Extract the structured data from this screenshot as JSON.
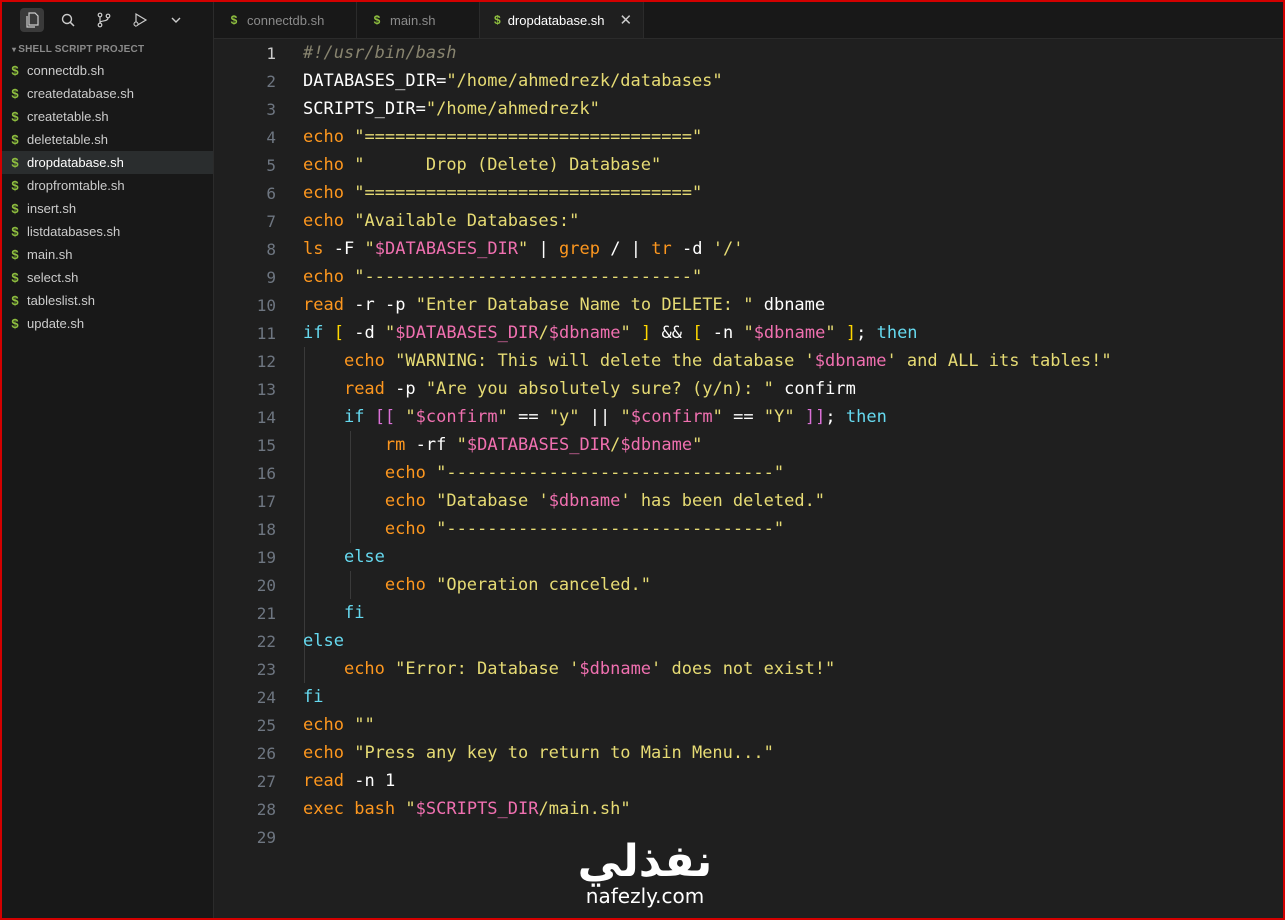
{
  "sidebar": {
    "section_title": "SHELL SCRIPT PROJECT",
    "files": [
      {
        "name": "connectdb.sh",
        "icon": "dollar-file-icon"
      },
      {
        "name": "createdatabase.sh",
        "icon": "dollar-file-icon"
      },
      {
        "name": "createtable.sh",
        "icon": "dollar-file-icon"
      },
      {
        "name": "deletetable.sh",
        "icon": "dollar-file-icon"
      },
      {
        "name": "dropdatabase.sh",
        "icon": "dollar-file-icon",
        "selected": true
      },
      {
        "name": "dropfromtable.sh",
        "icon": "dollar-file-icon"
      },
      {
        "name": "insert.sh",
        "icon": "dollar-file-icon"
      },
      {
        "name": "listdatabases.sh",
        "icon": "dollar-file-icon"
      },
      {
        "name": "main.sh",
        "icon": "dollar-file-icon"
      },
      {
        "name": "select.sh",
        "icon": "dollar-file-icon"
      },
      {
        "name": "tableslist.sh",
        "icon": "dollar-file-icon"
      },
      {
        "name": "update.sh",
        "icon": "dollar-file-icon"
      }
    ],
    "toolbar_icons": [
      "files-icon",
      "search-icon",
      "source-control-icon",
      "run-debug-icon",
      "chevron-down-icon"
    ]
  },
  "tabs": [
    {
      "label": "connectdb.sh",
      "active": false
    },
    {
      "label": "main.sh",
      "active": false
    },
    {
      "label": "dropdatabase.sh",
      "active": true,
      "close": "✕"
    }
  ],
  "file_marker": "$",
  "colors": {
    "keyword": "#fd971f",
    "string": "#e6db74",
    "variable": "#f070b0",
    "control": "#66d9ef",
    "comment": "#88846f",
    "accent_border": "#d30000"
  },
  "editor": {
    "current_line": 1,
    "lines": [
      {
        "n": "1",
        "text": "#!/usr/bin/bash"
      },
      {
        "n": "2",
        "text": "DATABASES_DIR=\"/home/ahmedrezk/databases\""
      },
      {
        "n": "3",
        "text": "SCRIPTS_DIR=\"/home/ahmedrezk\""
      },
      {
        "n": "4",
        "text": "echo \"================================\""
      },
      {
        "n": "5",
        "text": "echo \"      Drop (Delete) Database\""
      },
      {
        "n": "6",
        "text": "echo \"================================\""
      },
      {
        "n": "7",
        "text": "echo \"Available Databases:\""
      },
      {
        "n": "8",
        "text": "ls -F \"$DATABASES_DIR\" | grep / | tr -d '/'"
      },
      {
        "n": "9",
        "text": "echo \"--------------------------------\""
      },
      {
        "n": "10",
        "text": "read -r -p \"Enter Database Name to DELETE: \" dbname"
      },
      {
        "n": "11",
        "text": "if [ -d \"$DATABASES_DIR/$dbname\" ] && [ -n \"$dbname\" ]; then"
      },
      {
        "n": "12",
        "text": "    echo \"WARNING: This will delete the database '$dbname' and ALL its tables!\""
      },
      {
        "n": "13",
        "text": "    read -p \"Are you absolutely sure? (y/n): \" confirm"
      },
      {
        "n": "14",
        "text": "    if [[ \"$confirm\" == \"y\" || \"$confirm\" == \"Y\" ]]; then"
      },
      {
        "n": "15",
        "text": "        rm -rf \"$DATABASES_DIR/$dbname\""
      },
      {
        "n": "16",
        "text": "        echo \"--------------------------------\""
      },
      {
        "n": "17",
        "text": "        echo \"Database '$dbname' has been deleted.\""
      },
      {
        "n": "18",
        "text": "        echo \"--------------------------------\""
      },
      {
        "n": "19",
        "text": "    else"
      },
      {
        "n": "20",
        "text": "        echo \"Operation canceled.\""
      },
      {
        "n": "21",
        "text": "    fi"
      },
      {
        "n": "22",
        "text": "else"
      },
      {
        "n": "23",
        "text": "    echo \"Error: Database '$dbname' does not exist!\""
      },
      {
        "n": "24",
        "text": "fi"
      },
      {
        "n": "25",
        "text": "echo \"\""
      },
      {
        "n": "26",
        "text": "echo \"Press any key to return to Main Menu...\""
      },
      {
        "n": "27",
        "text": "read -n 1"
      },
      {
        "n": "28",
        "text": "exec bash \"$SCRIPTS_DIR/main.sh\""
      },
      {
        "n": "29",
        "text": ""
      }
    ]
  },
  "watermark": {
    "arabic": "نفذلي",
    "latin": "nafezly.com"
  }
}
